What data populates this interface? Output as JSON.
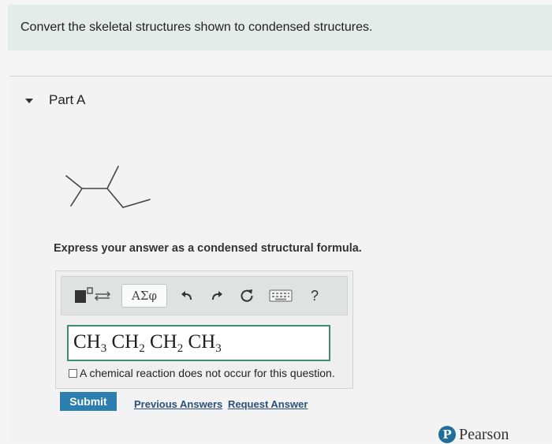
{
  "question": {
    "text": "Convert the skeletal structures shown to condensed structures."
  },
  "part": {
    "title": "Part A",
    "instruction": "Express your answer as a condensed structural formula."
  },
  "toolbar": {
    "symbols_label": "ΑΣφ",
    "help_label": "?"
  },
  "answer": {
    "formula": [
      {
        "base": "CH",
        "sub": "3"
      },
      {
        "base": " CH",
        "sub": "2"
      },
      {
        "base": " CH",
        "sub": "2"
      },
      {
        "base": " CH",
        "sub": "3"
      }
    ],
    "no_reaction_label": "A chemical reaction does not occur for this question."
  },
  "actions": {
    "submit_label": "Submit",
    "previous_answers_label": "Previous Answers",
    "request_answer_label": "Request Answer"
  },
  "footer": {
    "brand_logo_letter": "P",
    "brand_name": "Pearson"
  },
  "colors": {
    "banner": "#e4ecea",
    "submit": "#2c7fae",
    "input_border": "#3e8e73",
    "link": "#2a4f7a",
    "brand": "#1f6f98"
  }
}
